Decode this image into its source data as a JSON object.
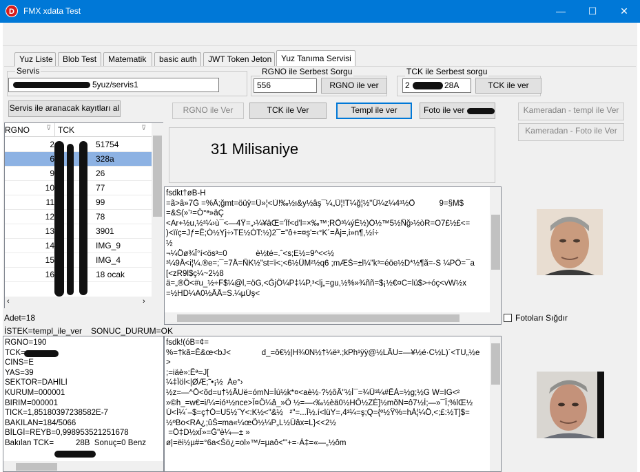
{
  "window": {
    "title": "FMX xdata Test",
    "icon_letter": "D",
    "minimize_glyph": "—",
    "maximize_glyph": "☐",
    "close_glyph": "✕"
  },
  "tabs": [
    {
      "label": "Yuz Liste"
    },
    {
      "label": "Blob Test"
    },
    {
      "label": "Matematik"
    },
    {
      "label": "basic auth"
    },
    {
      "label": "JWT Token Jeton"
    },
    {
      "label": "Yuz Tanıma Servisi"
    }
  ],
  "servis": {
    "group_label": "Servis",
    "url_visible_suffix": "5yuz/servis1"
  },
  "rgno_query": {
    "group_label": "RGNO ile Serbest Sorgu",
    "value": "556",
    "button": "RGNO ile ver"
  },
  "tck_query": {
    "group_label": "TCK ile Serbest sorgu",
    "value_prefix": "2",
    "value_suffix": "28A",
    "button": "TCK ile ver"
  },
  "toolbar": {
    "search_button": "Servis ile aranacak kayıtları al",
    "rgno_button": "RGNO ile Ver",
    "tck_button": "TCK ile Ver",
    "templ_button": "Templ ile ver",
    "foto_button": "Foto ile ver",
    "camera_templ_button": "Kameradan - templ ile Ver",
    "camera_foto_button": "Kameradan - Foto ile Ver"
  },
  "grid": {
    "headers": [
      "RGNO",
      "TCK"
    ],
    "rows": [
      {
        "rgno": "2",
        "tck": "51754"
      },
      {
        "rgno": "6",
        "tck": "328a"
      },
      {
        "rgno": "9",
        "tck": "26"
      },
      {
        "rgno": "10",
        "tck": "77"
      },
      {
        "rgno": "11",
        "tck": "99"
      },
      {
        "rgno": "12",
        "tck": "78"
      },
      {
        "rgno": "13",
        "tck": "3901"
      },
      {
        "rgno": "14",
        "tck": "IMG_9"
      },
      {
        "rgno": "15",
        "tck": "IMG_4"
      },
      {
        "rgno": "16",
        "tck": "18 ocak"
      }
    ],
    "selected_index": 1,
    "count_label": "Adet=18"
  },
  "timing": {
    "text": "31 Milisaniye"
  },
  "memo_top": {
    "lines": [
      "fsdkt†øB-H",
      "=ã>â»7Ğ =%Â;ğmt=öüÿ=Û»¦<Ù!‰½ı&y½âş¯¼„Û¦!T¼ğ¦½\"Ü¼z¼4³½Õ           9=§M$",
      "=&S(»'¹=Ö°ª»äÇ",
      "<Ar+½u,½³¼›ù¯<—4Ÿ=„›¼¥äŒ='Ïf<d'l=×‰™;RÕ³¼ýÉ½)Ó½™5½Ñğ›½òR=O7£½£<=",
      ")<ïïç=Jƒ=Ë;Ó½Yj÷›TE½ÓT:½)2¯=\"ô+=¤ş'=‹°K´=Åj=,i»n¶,½í÷",
      "½",
      "¬¼Öø¾Ï°í<ös³=0             è½té=.ˆ<s;E½=9^<<½",
      "³¼9Å<i¦¼.®e=;¯=7Å=ÑK½\"st=ï<;<6½ÜM²½q6 ;mÆŠ=±l¼\"k³=éöe½D*½¶ã=-S ¼PÔ=¯a",
      "[<zR9l$ç¼~2½8",
      "ä=„®Ö<#u_½÷F$¼@l,=öG,<ĞjÖ¼P‡¼P,³<lj„=gu,½%»¾ññ=$¡½€¤C=lü$>÷óç<vW½x",
      "=½HD¼A0½ÂÅ=S.¼µÚş<"
    ]
  },
  "status": {
    "istek": "İSTEK=templ_ile_ver",
    "sonuc": "SONUC_DURUM=OK"
  },
  "memo_left": {
    "lines": [
      "RGNO=190",
      "TCK=",
      "CINS=E",
      "YAS=39",
      "SEKTOR=DAHİLİ",
      "KURUM=000001",
      "BIRIM=000001",
      "TICK=1,85180397238582E-7",
      "BAKILAN=184/5066",
      "BİLGİ=REYB=0,998953521251678",
      "Bakılan TCK=          28B  Sonuç=0 Benz"
    ],
    "tck_suffix": "28B"
  },
  "memo_right": {
    "lines": [
      "fsdk!(óB=¢=",
      "%=†kã=Ê&œ<bJ<              d_=ô€½|H¾0N½†¼ë³.;kPh¹ÿÿ@½LÂU=—¥½é·C½L)´<TU„½e",
      ">",
      ";=iäè»:Êª=J[",
      "¼‡Ïöl<|ØÆ;˜•¡½  Áe°›",
      "½z=—^Ö<õd=u†½ÂUë=ómN=Íú½k*¤<aè½·?½ôÂ\"½Í¯=¾Û³¼#ÊÀ=½g;½G W=IG<²",
      "»©h_=w€=i/¼=ió³½nce>Î¤Ö¼â_»Õ ½=—‹‰½èä0½HÕ½ZÈ]½mõN=ô7½Í;—»¯Î;%lŒ½",
      "Ú<Í¼´–$=ç†Ó=U5½˝Y<:K½<\"&½   ²\"=...Î½.í<lüY=,4³¼=ş;Q={º½Ÿ%=hÀ¦¼Ö,<;£:½T]$=",
      "½ºBo<RA¿;ûŠ=ma«¼œÕ½¼P„L½Ûâx=L}<<2½",
      " =Õ‡D½xÎ»=Ğ\"è¼—± »",
      "ø|=ëi½µ#=°6a<Šö¿=ol»™/=µaô<\"'+=·Á‡=«—„½ôm"
    ]
  },
  "checkbox": {
    "label": "Fotoları Sığdır",
    "checked": false
  },
  "colors": {
    "titlebar": "#0078d7",
    "selection": "#8db2e3",
    "focus": "#0078d7"
  }
}
